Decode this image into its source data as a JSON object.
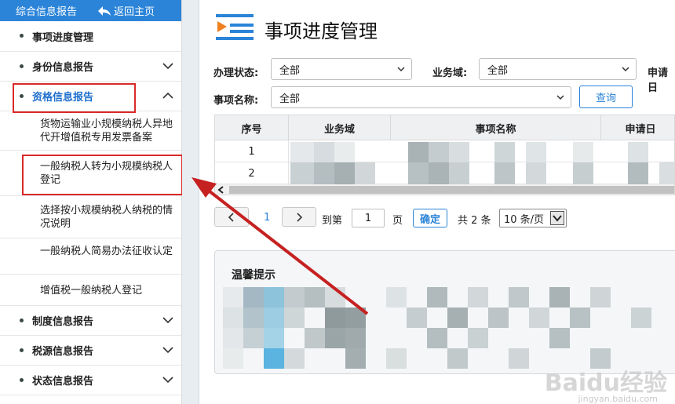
{
  "sidebar": {
    "title": "综合信息报告",
    "back_label": "返回主页",
    "items": [
      {
        "label": "事项进度管理"
      },
      {
        "label": "身份信息报告"
      },
      {
        "label": "资格信息报告"
      },
      {
        "label": "制度信息报告"
      },
      {
        "label": "税源信息报告"
      },
      {
        "label": "状态信息报告"
      }
    ],
    "sub_items": [
      {
        "label": "货物运输业小规模纳税人异地代开增值税专用发票备案"
      },
      {
        "label": "一般纳税人转为小规模纳税人登记"
      },
      {
        "label": "选择按小规模纳税人纳税的情况说明"
      },
      {
        "label": "一般纳税人简易办法征收认定"
      },
      {
        "label": "增值税一般纳税人登记"
      }
    ]
  },
  "main": {
    "title": "事项进度管理",
    "filters": {
      "status_label": "办理状态:",
      "status_value": "全部",
      "domain_label": "业务域:",
      "domain_value": "全部",
      "date_label": "申请日",
      "name_label": "事项名称:",
      "name_value": "全部",
      "query_button": "查询"
    },
    "table": {
      "headers": [
        "序号",
        "业务域",
        "事项名称",
        "申请日"
      ],
      "rows": [
        {
          "num": "1"
        },
        {
          "num": "2"
        }
      ]
    },
    "pagination": {
      "current_page": "1",
      "goto_label": "到第",
      "goto_value": "1",
      "page_unit": "页",
      "confirm": "确定",
      "total": "共 2 条",
      "page_size": "10 条/页"
    },
    "tip": {
      "title": "温馨提示"
    }
  },
  "watermark": {
    "text": "Baidu经验",
    "sub": "jingyan.baidu.com"
  },
  "colors": {
    "accent": "#2b84d8",
    "highlight_red": "#d92a2a",
    "active_text": "#1e6fcc"
  }
}
